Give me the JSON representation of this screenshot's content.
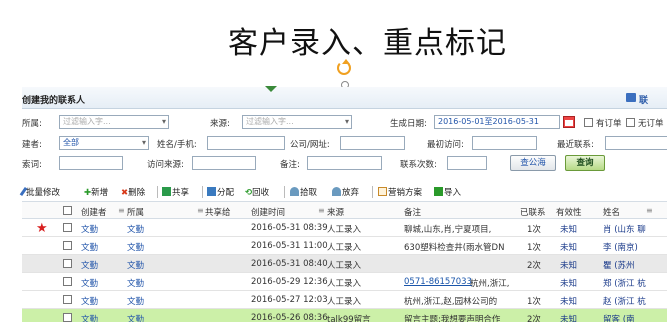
{
  "slide_title": "客户录入、重点标记",
  "panel": {
    "title": "创建我的联系人",
    "top_link": "联"
  },
  "form": {
    "row1": {
      "category_label": "所属:",
      "category_placeholder": "过滤输入字...",
      "source_label": "来源:",
      "source_placeholder": "过滤输入字...",
      "gen_date_label": "生成日期:",
      "gen_date_value": "2016-05-01至2016-05-31",
      "has_order_label": "有订单",
      "no_order_label": "无订单"
    },
    "row2": {
      "creator_label": "建者:",
      "creator_value": "全部",
      "name_phone_label": "姓名/手机:",
      "company_url_label": "公司/网址:",
      "recent_visit_label": "最初访问:",
      "recent_contact_label": "最近联系:"
    },
    "row3": {
      "keyword_label": "索词:",
      "visit_source_label": "访问来源:",
      "remark_label": "备注:",
      "contact_count_label": "联系次数:",
      "search_public_button": "查公海",
      "search_button": "查询"
    }
  },
  "toolbar": {
    "items": [
      {
        "label": "批量修改",
        "icon": "pencil-icon",
        "color": "#3a6fbf"
      },
      {
        "label": "新增",
        "icon": "plus-icon",
        "color": "#2a9a2a"
      },
      {
        "label": "删除",
        "icon": "cross-icon",
        "color": "#d83a1a"
      },
      {
        "label": "共享",
        "icon": "share-icon",
        "color": "#2a9a4a"
      },
      {
        "label": "分配",
        "icon": "assign-icon",
        "color": "#3a7abf"
      },
      {
        "label": "回收",
        "icon": "recycle-icon",
        "color": "#2a9a2a"
      },
      {
        "label": "拾取",
        "icon": "pick-icon",
        "color": "#6a9abf"
      },
      {
        "label": "放弃",
        "icon": "drop-icon",
        "color": "#6a9abf"
      },
      {
        "label": "营销方案",
        "icon": "plan-icon",
        "color": "#c88a2a"
      },
      {
        "label": "导入",
        "icon": "import-icon",
        "color": "#2a9a2a"
      }
    ]
  },
  "table": {
    "columns": [
      "创建者",
      "所属",
      "共享给",
      "创建时间",
      "来源",
      "备注",
      "已联系",
      "有效性",
      "姓名"
    ],
    "rows": [
      {
        "starred": true,
        "creator": "文勤",
        "owner": "文勤",
        "shared": "",
        "time": "2016-05-31 08:39",
        "source": "人工录入",
        "remark": "聊城,山东,肖,宁夏项目,",
        "contacted": "1次",
        "valid": "未知",
        "name": "肖 (山东 聊",
        "style": ""
      },
      {
        "starred": false,
        "creator": "文勤",
        "owner": "文勤",
        "shared": "",
        "time": "2016-05-31 11:00",
        "source": "人工录入",
        "remark": "630塑料检查井(雨水管DN",
        "contacted": "1次",
        "valid": "未知",
        "name": "李 (南京)",
        "style": ""
      },
      {
        "starred": false,
        "creator": "文勤",
        "owner": "文勤",
        "shared": "",
        "time": "2016-05-31 08:40",
        "source": "人工录入",
        "remark": "",
        "contacted": "2次",
        "valid": "未知",
        "name": "瞿 (苏州",
        "style": "alt"
      },
      {
        "starred": false,
        "creator": "文勤",
        "owner": "文勤",
        "shared": "",
        "time": "2016-05-29 12:36",
        "source": "人工录入",
        "remark": "0571-86157033",
        "remark_suffix": " 杭州,浙江,",
        "contacted": "",
        "valid": "未知",
        "name": "郑 (浙江 杭",
        "style": ""
      },
      {
        "starred": false,
        "creator": "文勤",
        "owner": "文勤",
        "shared": "",
        "time": "2016-05-27 12:03",
        "source": "人工录入",
        "remark": "杭州,浙江,赵,园林公司的",
        "contacted": "1次",
        "valid": "未知",
        "name": "赵 (浙江 杭",
        "style": ""
      },
      {
        "starred": false,
        "creator": "文勤",
        "owner": "文勤",
        "shared": "",
        "time": "2016-05-26 08:36",
        "source": "talk99留言",
        "remark": "留言主题:我想要声明合作",
        "contacted": "2次",
        "valid": "未知",
        "name": "留客 (南",
        "style": "hi"
      }
    ]
  }
}
